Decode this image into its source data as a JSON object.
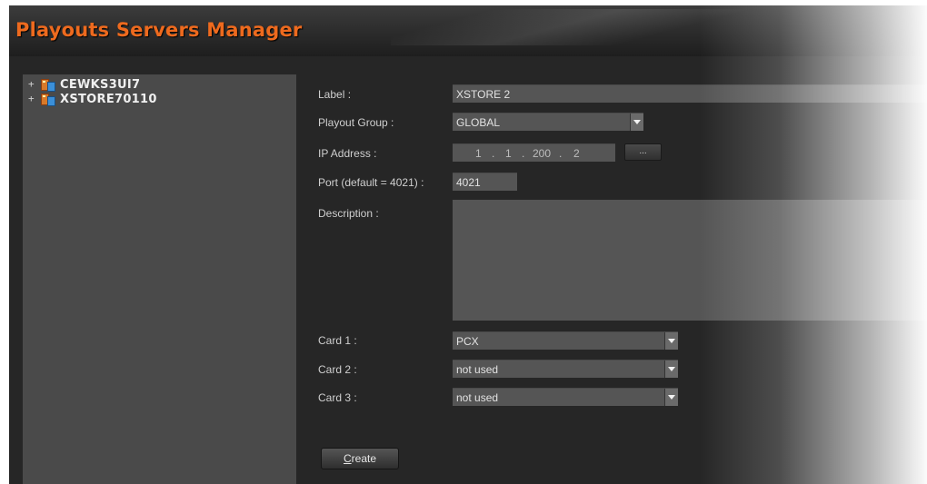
{
  "app": {
    "title": "Playouts Servers Manager"
  },
  "tree": {
    "items": [
      {
        "expander": "+",
        "icon": "server-icon",
        "label": "CEWKS3UI7"
      },
      {
        "expander": "+",
        "icon": "server-icon",
        "label": "XSTORE70110"
      }
    ]
  },
  "form": {
    "label": {
      "caption": "Label :",
      "value": "XSTORE 2"
    },
    "playout_group": {
      "caption": "Playout Group :",
      "value": "GLOBAL"
    },
    "ip_address": {
      "caption": "IP Address :",
      "octets": [
        "1",
        "1",
        "200",
        "2"
      ],
      "separator": ".",
      "browse_label": "..."
    },
    "port": {
      "caption": "Port (default = 4021) :",
      "value": "4021"
    },
    "description": {
      "caption": "Description :",
      "value": ""
    },
    "card1": {
      "caption": "Card 1 :",
      "value": "PCX"
    },
    "card2": {
      "caption": "Card 2 :",
      "value": "not used"
    },
    "card3": {
      "caption": "Card 3 :",
      "value": "not used"
    }
  },
  "buttons": {
    "create": {
      "mnemonic": "C",
      "rest": "reate"
    }
  },
  "colors": {
    "accent": "#ee6a1e",
    "panel": "#4a4a4a",
    "background": "#262626",
    "field": "#555555"
  }
}
